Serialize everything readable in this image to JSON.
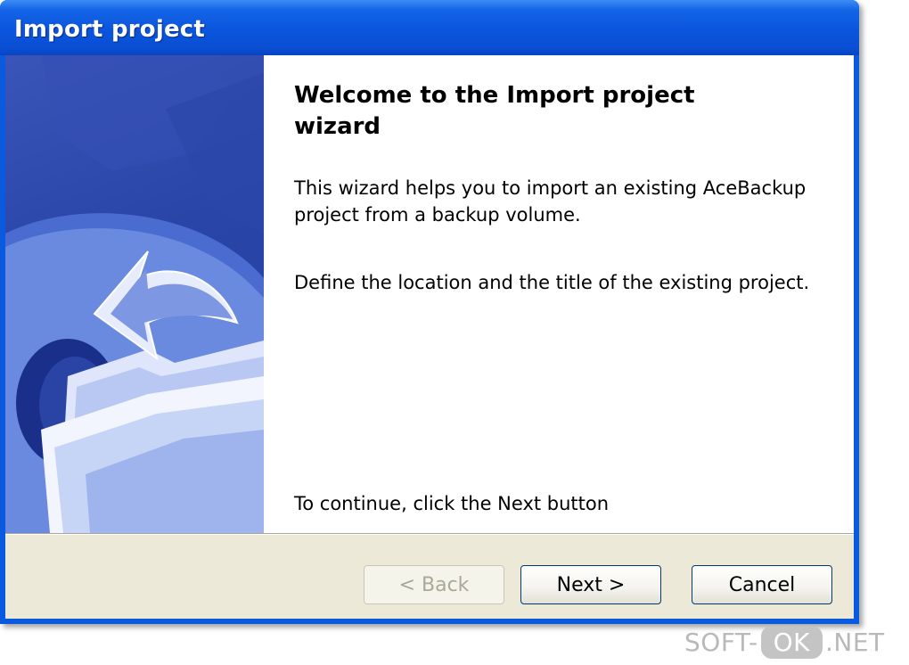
{
  "window": {
    "title": "Import project"
  },
  "wizard": {
    "heading": "Welcome to the Import project wizard",
    "paragraph_1": "This wizard helps you to import an existing AceBackup project from a backup volume.",
    "paragraph_2": "Define the location and the title of the existing project.",
    "paragraph_3": "To continue, click the Next button"
  },
  "buttons": {
    "back_label": "< Back",
    "next_label": "Next >",
    "cancel_label": "Cancel"
  },
  "watermark": {
    "prefix": "SOFT-",
    "badge": "OK",
    "suffix": ".NET"
  },
  "colors": {
    "titlebar": "#0a55dd",
    "banner": "#2a45a8",
    "dialog_face": "#ece9d8",
    "button_border": "#003c74",
    "disabled_text": "#aca899"
  },
  "icons": {
    "banner": "folder-with-arrow-illustration"
  }
}
